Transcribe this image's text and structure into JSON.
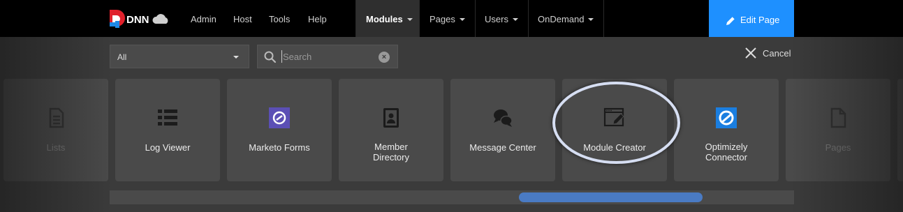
{
  "header": {
    "logo_text": "DNN",
    "nav": [
      {
        "label": "Admin"
      },
      {
        "label": "Host"
      },
      {
        "label": "Tools"
      },
      {
        "label": "Help"
      }
    ],
    "menus": [
      {
        "label": "Modules"
      },
      {
        "label": "Pages"
      },
      {
        "label": "Users"
      },
      {
        "label": "OnDemand"
      }
    ],
    "edit_page_label": "Edit Page",
    "edit_page_color": "#1e90ff"
  },
  "filters": {
    "category_value": "All",
    "search_placeholder": "Search",
    "search_value": ""
  },
  "cancel_label": "Cancel",
  "modules": [
    {
      "name": "Lists",
      "icon": "list-document-icon"
    },
    {
      "name": "Log Viewer",
      "icon": "log-list-icon"
    },
    {
      "name": "Marketo Forms",
      "icon": "marketo-icon"
    },
    {
      "name": "Member Directory",
      "icon": "contact-book-icon"
    },
    {
      "name": "Message Center",
      "icon": "chat-bubbles-icon"
    },
    {
      "name": "Module Creator",
      "icon": "module-edit-icon"
    },
    {
      "name": "Optimizely Connector",
      "icon": "optimizely-icon"
    },
    {
      "name": "Pages",
      "icon": "page-icon"
    }
  ],
  "highlighted_module": "Module Creator",
  "scroll_position": 0.6
}
